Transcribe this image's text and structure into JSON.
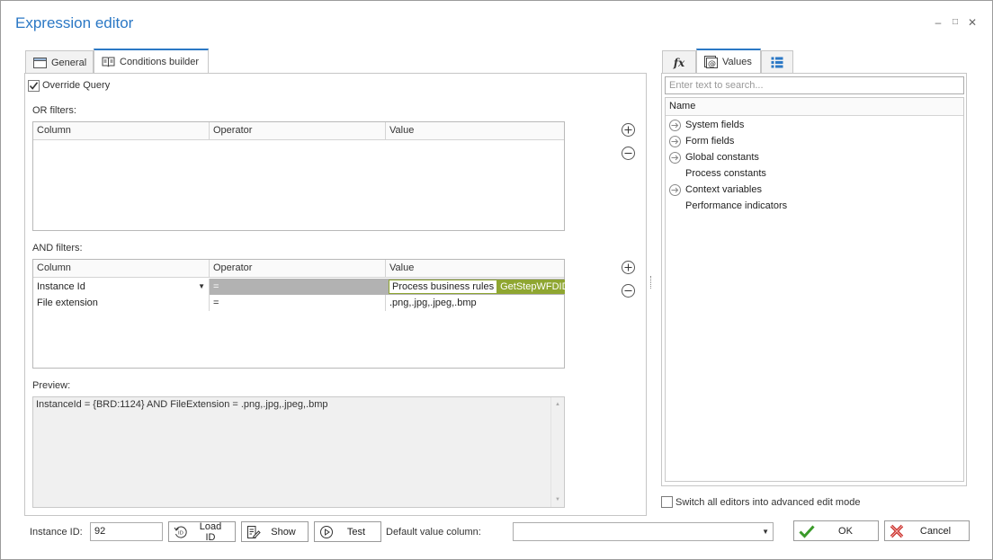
{
  "window": {
    "title": "Expression editor",
    "controls": {
      "minimize": "–",
      "maximize": "□",
      "close": "✕"
    }
  },
  "left_tabs": [
    {
      "label": "General",
      "icon": "window-icon",
      "active": false
    },
    {
      "label": "Conditions builder",
      "icon": "book-icon",
      "active": true
    }
  ],
  "override_query": {
    "label": "Override Query",
    "checked": true
  },
  "or_filters": {
    "label": "OR filters:",
    "columns": [
      "Column",
      "Operator",
      "Value"
    ],
    "rows": []
  },
  "and_filters": {
    "label": "AND filters:",
    "columns": [
      "Column",
      "Operator",
      "Value"
    ],
    "rows": [
      {
        "column": "Instance Id",
        "operator": "=",
        "value_tag": "Process business rules",
        "value_fn": "GetStepWFDID"
      },
      {
        "column": "File extension",
        "operator": "=",
        "value": ".png,.jpg,.jpeg,.bmp"
      }
    ]
  },
  "preview": {
    "label": "Preview:",
    "text": "InstanceId = {BRD:1124} AND FileExtension = .png,.jpg,.jpeg,.bmp"
  },
  "bottom": {
    "instance_id_label": "Instance ID:",
    "instance_id_value": "92",
    "load_id": "Load ID",
    "show": "Show",
    "test": "Test",
    "default_value_label": "Default value column:",
    "default_value": "",
    "ok": "OK",
    "cancel": "Cancel"
  },
  "right_tabs": [
    {
      "label": "",
      "icon": "fx-icon",
      "active": false
    },
    {
      "label": "Values",
      "icon": "at-icon",
      "active": true
    },
    {
      "label": "",
      "icon": "list-icon",
      "active": false
    }
  ],
  "right_panel": {
    "search_placeholder": "Enter text to search...",
    "header": "Name",
    "items": [
      {
        "label": "System fields",
        "expandable": true
      },
      {
        "label": "Form fields",
        "expandable": true
      },
      {
        "label": "Global constants",
        "expandable": true
      },
      {
        "label": "Process constants",
        "expandable": false
      },
      {
        "label": "Context variables",
        "expandable": true
      },
      {
        "label": "Performance indicators",
        "expandable": false
      }
    ],
    "advanced_mode": {
      "label": "Switch all editors into advanced edit mode",
      "checked": false
    }
  },
  "colors": {
    "accent": "#2b78c5",
    "selected_row": "#b2b2b2",
    "function_tag": "#8fa631",
    "ok_check": "#3a9a2a",
    "cancel_x": "#c9302c"
  }
}
